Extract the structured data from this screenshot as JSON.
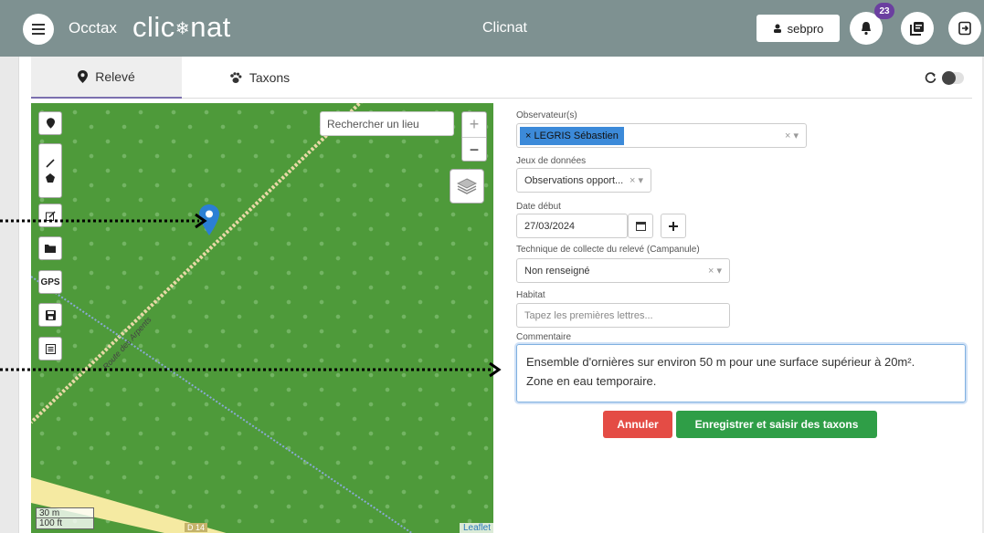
{
  "header": {
    "app_name": "Occtax",
    "logo_text_left": "clic",
    "logo_text_right": "nat",
    "center_title": "Clicnat",
    "user_label": "sebpro",
    "notification_count": "23"
  },
  "tabs": [
    {
      "label": "Relevé",
      "active": true
    },
    {
      "label": "Taxons",
      "active": false
    }
  ],
  "map": {
    "search_placeholder": "Rechercher un lieu",
    "zoom_in": "+",
    "zoom_out": "−",
    "gps_label": "GPS",
    "scale_metric": "30 m",
    "scale_imperial": "100 ft",
    "attribution": "Leaflet",
    "road_label_1": "Route des Arpents",
    "road_label_2": "D 14"
  },
  "form": {
    "observers_label": "Observateur(s)",
    "observer_chip": "LEGRIS Sébastien",
    "dataset_label": "Jeux de données",
    "dataset_value": "Observations opport...",
    "date_label": "Date début",
    "date_value": "27/03/2024",
    "technique_label": "Technique de collecte du relevé (Campanule)",
    "technique_value": "Non renseigné",
    "habitat_label": "Habitat",
    "habitat_placeholder": "Tapez les premières lettres...",
    "comment_label": "Commentaire",
    "comment_line1": "Ensemble d'ornières sur environ 50 m pour une surface supérieur à 20m².",
    "comment_line2": "Zone en eau temporaire.",
    "cancel_label": "Annuler",
    "save_label": "Enregistrer et saisir des taxons"
  },
  "colors": {
    "header_bg": "#7e9191",
    "cancel": "#e44c45",
    "save": "#2f9e47",
    "chip": "#3c8ad9",
    "badge": "#6b3fa0"
  }
}
